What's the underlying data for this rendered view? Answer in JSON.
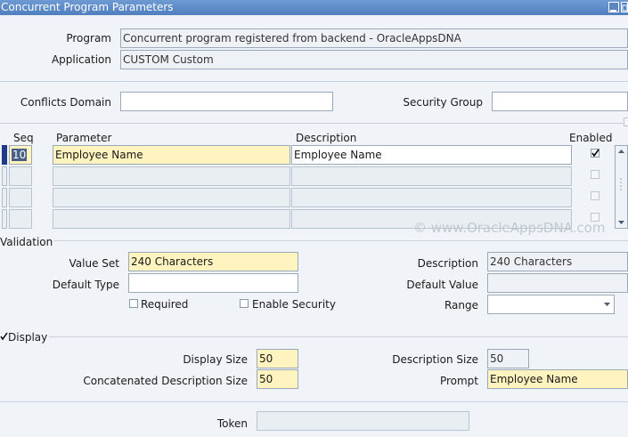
{
  "window": {
    "title": "Concurrent Program Parameters"
  },
  "header": {
    "program_label": "Program",
    "program_value": "Concurrent program registered from backend - OracleAppsDNA",
    "application_label": "Application",
    "application_value": "CUSTOM Custom"
  },
  "domain": {
    "conflicts_label": "Conflicts Domain",
    "conflicts_value": "",
    "security_label": "Security Group",
    "security_value": ""
  },
  "grid": {
    "col_seq": "Seq",
    "col_parameter": "Parameter",
    "col_description": "Description",
    "col_enabled": "Enabled",
    "rows": [
      {
        "seq": "10",
        "parameter": "Employee Name",
        "description": "Employee Name",
        "enabled": true
      },
      {
        "seq": "",
        "parameter": "",
        "description": "",
        "enabled": false
      },
      {
        "seq": "",
        "parameter": "",
        "description": "",
        "enabled": false
      },
      {
        "seq": "",
        "parameter": "",
        "description": "",
        "enabled": false
      }
    ]
  },
  "watermark": "© www.OracleAppsDNA.com",
  "validation": {
    "section_label": "Validation",
    "value_set_label": "Value Set",
    "value_set_value": "240 Characters",
    "description_label": "Description",
    "description_value": "240 Characters",
    "default_type_label": "Default Type",
    "default_type_value": "",
    "default_value_label": "Default Value",
    "default_value_value": "",
    "required_label": "Required",
    "required_checked": false,
    "enable_security_label": "Enable Security",
    "enable_security_checked": false,
    "range_label": "Range",
    "range_value": ""
  },
  "display": {
    "section_label": "Display",
    "checked": true,
    "display_size_label": "Display Size",
    "display_size_value": "50",
    "description_size_label": "Description Size",
    "description_size_value": "50",
    "concat_desc_size_label": "Concatenated Description Size",
    "concat_desc_size_value": "50",
    "prompt_label": "Prompt",
    "prompt_value": "Employee Name"
  },
  "token": {
    "label": "Token",
    "value": ""
  },
  "colors": {
    "titlebar": "#4f7fbf",
    "required_field": "#fff3bf",
    "background": "#f0f4f8"
  }
}
